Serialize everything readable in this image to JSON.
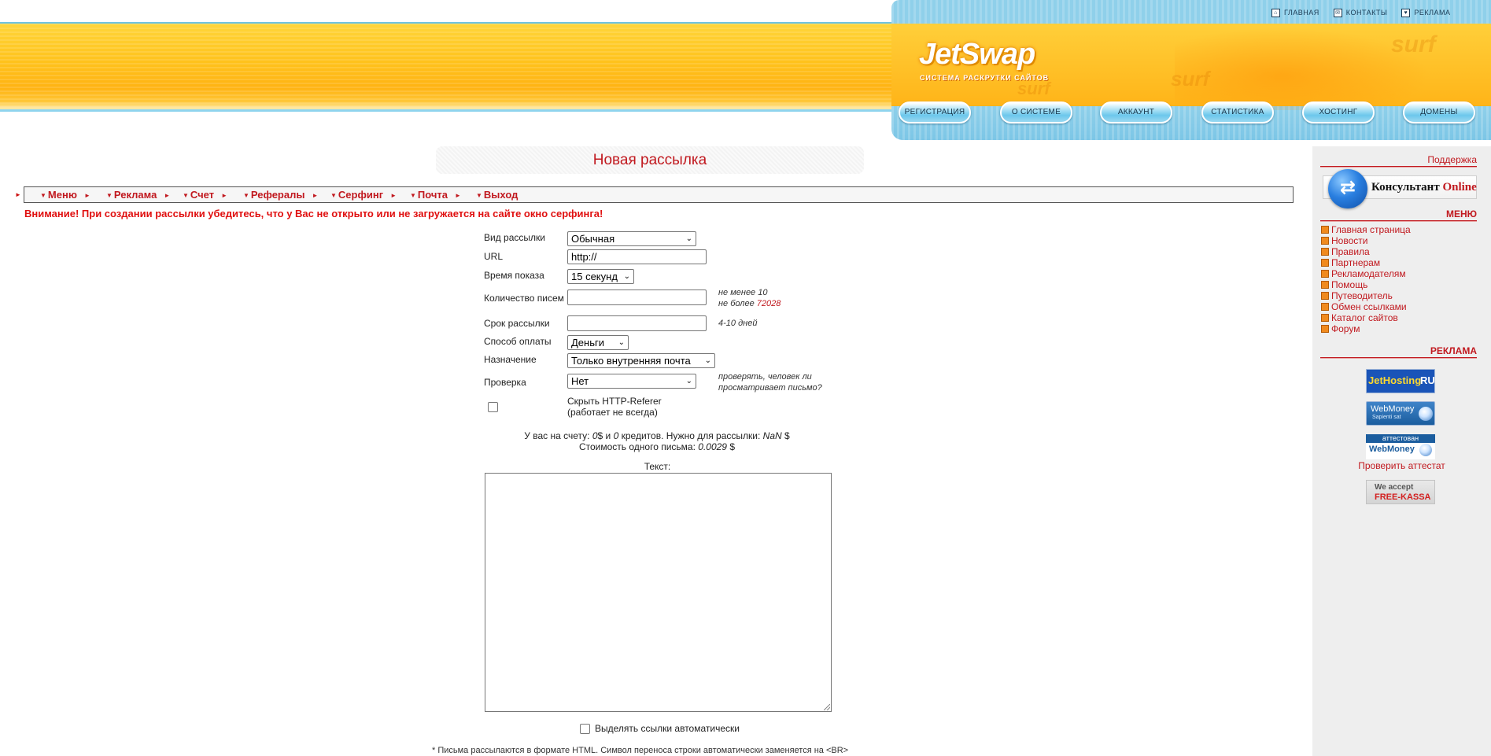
{
  "header": {
    "logo": "JetSwap",
    "logo_subtitle": "СИСТЕМА РАСКРУТКИ САЙТОВ",
    "top_links": [
      {
        "label": "ГЛАВНАЯ",
        "icon": "home-icon"
      },
      {
        "label": "КОНТАКТЫ",
        "icon": "mail-icon"
      },
      {
        "label": "РЕКЛАМА",
        "icon": "ad-icon"
      }
    ],
    "nav": [
      "РЕГИСТРАЦИЯ",
      "О СИСТЕМЕ",
      "АККАУНТ",
      "СТАТИСТИКА",
      "ХОСТИНГ",
      "ДОМЕНЫ"
    ],
    "decor_word": "surf"
  },
  "page_title": "Новая рассылка",
  "menu": [
    "Меню",
    "Реклама",
    "Счет",
    "Рефералы",
    "Серфинг",
    "Почта",
    "Выход"
  ],
  "warning": "Внимание! При создании рассылки убедитесь, что у Вас не открыто или не загружается на сайте окно серфинга!",
  "form": {
    "type_label": "Вид рассылки",
    "type_value": "Обычная",
    "url_label": "URL",
    "url_value": "http://",
    "time_label": "Время показа",
    "time_value": "15 секунд",
    "count_label": "Количество писем",
    "count_value": "",
    "count_hint_min": "не менее 10",
    "count_hint_max_prefix": "не более",
    "count_hint_max_value": "72028",
    "term_label": "Срок рассылки",
    "term_value": "",
    "term_hint": "4-10 дней",
    "payment_label": "Способ оплаты",
    "payment_value": "Деньги",
    "purpose_label": "Назначение",
    "purpose_value": "Только внутренняя почта",
    "check_label": "Проверка",
    "check_value": "Нет",
    "check_hint_line1": "проверять, человек ли",
    "check_hint_line2": "просматривает письмо?",
    "hide_referer_line1": "Скрыть HTTP-Referer",
    "hide_referer_line2": "(работает не всегда)",
    "hide_referer_checked": false
  },
  "account": {
    "prefix": "У вас на счету:",
    "money": "0",
    "money_unit": "$ и",
    "credits": "0",
    "credits_suffix": "кредитов. Нужно для рассылки:",
    "needed": "NaN",
    "needed_unit": "$",
    "cost_label": "Стоимость одного письма:",
    "cost_value": "0.0029",
    "cost_unit": "$"
  },
  "text_label": "Текст:",
  "text_value": "",
  "auto_links_label": "Выделять ссылки автоматически",
  "auto_links_checked": false,
  "footnote": "* Письма рассылаются в формате HTML. Символ переноса строки автоматически заменяется на <BR>",
  "sidebar": {
    "support_title": "Поддержка",
    "consultant_text": "Консультант",
    "consultant_online": "Online",
    "menu_title": "МЕНЮ",
    "menu_items": [
      "Главная страница",
      "Новости",
      "Правила",
      "Партнерам",
      "Рекламодателям",
      "Помощь",
      "Путеводитель",
      "Обмен ссылками",
      "Каталог сайтов",
      "Форум"
    ],
    "ads_title": "РЕКЛАМА",
    "ad_jethosting_a": "JetHosting",
    "ad_jethosting_b": "RU",
    "ad_webmoney": "WebMoney",
    "ad_webmoney_sub": "Sapienti sat",
    "ad_attested": "аттестован",
    "verify_link": "Проверить аттестат",
    "ad_fk_top": "We accept",
    "ad_fk_bottom": "FREE-KASSA"
  },
  "colors": {
    "accent_red": "#c1191f",
    "warning_red": "#e01010",
    "header_yellow": "#ffc21c",
    "header_blue": "#8fd0ea"
  }
}
